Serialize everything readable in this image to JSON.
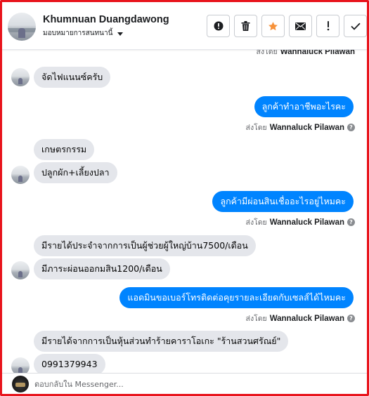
{
  "header": {
    "contact_name": "Khumnuan Duangdawong",
    "assign_label": "มอบหมายการสนทนานี้",
    "actions": [
      {
        "name": "spam-button",
        "icon": "alert-circle-icon"
      },
      {
        "name": "delete-button",
        "icon": "trash-icon"
      },
      {
        "name": "star-button",
        "icon": "star-icon",
        "color": "#f7923a"
      },
      {
        "name": "mark-unread-button",
        "icon": "envelope-icon"
      },
      {
        "name": "follow-up-button",
        "icon": "exclamation-icon"
      },
      {
        "name": "mark-done-button",
        "icon": "checkmark-icon"
      }
    ]
  },
  "thread": {
    "sent_by_prefix": "ส่งโดย",
    "agent_name": "Wannaluck Pilawan",
    "help_glyph": "?",
    "messages": [
      {
        "dir": "in",
        "text": "จัดไฟแนนซ์ครับ"
      },
      {
        "dir": "out",
        "text": "ลูกค้าทำอาชีพอะไรคะ"
      },
      {
        "dir": "in",
        "text": "เกษตรกรรม"
      },
      {
        "dir": "in",
        "text": "ปลูกผัก+เลี้ยงปลา"
      },
      {
        "dir": "out",
        "text": "ลูกค้ามีผ่อนสินเชื่ออะไรอยู่ไหมคะ"
      },
      {
        "dir": "in",
        "text": "มีรายได้ประจำจากการเป็นผู้ช่วยผู้ใหญ่บ้าน7500/เดือน"
      },
      {
        "dir": "in",
        "text": "มีภาระผ่อนออกมสิน1200/เดือน"
      },
      {
        "dir": "out",
        "text": "แอดมินขอเบอร์โทรติดต่อคุยรายละเอียดกับเซลส์ได้ไหมคะ"
      },
      {
        "dir": "in",
        "text": "มีรายได้จากการเป็นหุ้นส่วนทำร้ายคาราโอเกะ \"ร้านสวนศรัณย์\""
      },
      {
        "dir": "in",
        "text": "0991379943"
      }
    ]
  },
  "composer": {
    "placeholder": "ตอบกลับใน Messenger..."
  },
  "colors": {
    "outgoing_bubble": "#0084ff",
    "incoming_bubble": "#e4e6eb",
    "frame": "#e8141c"
  }
}
